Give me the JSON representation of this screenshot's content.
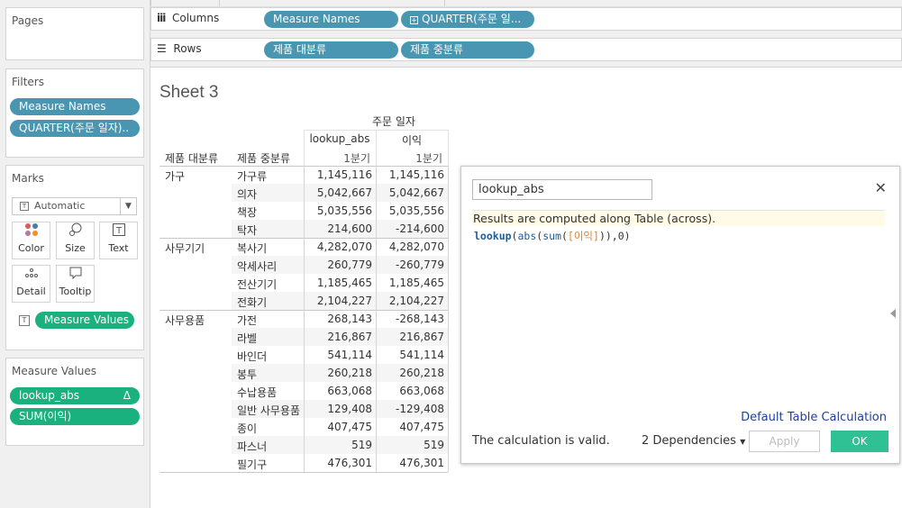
{
  "left": {
    "pages_title": "Pages",
    "filters_title": "Filters",
    "filters": [
      "Measure Names",
      "QUARTER(주문 일자).."
    ],
    "marks_title": "Marks",
    "marks_type": "Automatic",
    "marks_buttons": [
      "Color",
      "Size",
      "Text",
      "Detail",
      "Tooltip"
    ],
    "marks_pill": "Measure Values",
    "measure_values_title": "Measure Values",
    "measure_values": [
      "lookup_abs",
      "SUM(이익)"
    ],
    "delta_symbol": "Δ"
  },
  "shelves": {
    "columns_label": "Columns",
    "columns": [
      "Measure Names",
      "QUARTER(주문 일..."
    ],
    "rows_label": "Rows",
    "rows": [
      "제품 대분류",
      "제품 중분류"
    ]
  },
  "sheet": {
    "title": "Sheet 3",
    "col_group": "주문 일자",
    "measures": [
      "lookup_abs",
      "이익"
    ],
    "quarter": "1분기",
    "row_header_1": "제품 대분류",
    "row_header_2": "제품 중분류",
    "groups": [
      {
        "name": "가구",
        "rows": [
          [
            "가구류",
            "1,145,116",
            "1,145,116"
          ],
          [
            "의자",
            "5,042,667",
            "5,042,667"
          ],
          [
            "책장",
            "5,035,556",
            "5,035,556"
          ],
          [
            "탁자",
            "214,600",
            "-214,600"
          ]
        ]
      },
      {
        "name": "사무기기",
        "rows": [
          [
            "복사기",
            "4,282,070",
            "4,282,070"
          ],
          [
            "악세사리",
            "260,779",
            "-260,779"
          ],
          [
            "전산기기",
            "1,185,465",
            "1,185,465"
          ],
          [
            "전화기",
            "2,104,227",
            "2,104,227"
          ]
        ]
      },
      {
        "name": "사무용품",
        "rows": [
          [
            "가전",
            "268,143",
            "-268,143"
          ],
          [
            "라벨",
            "216,867",
            "216,867"
          ],
          [
            "바인더",
            "541,114",
            "541,114"
          ],
          [
            "봉투",
            "260,218",
            "260,218"
          ],
          [
            "수납용품",
            "663,068",
            "663,068"
          ],
          [
            "일반 사무용품",
            "129,408",
            "-129,408"
          ],
          [
            "종이",
            "407,475",
            "407,475"
          ],
          [
            "파스너",
            "519",
            "519"
          ],
          [
            "필기구",
            "476,301",
            "476,301"
          ]
        ]
      }
    ]
  },
  "dialog": {
    "name": "lookup_abs",
    "hint": "Results are computed along Table (across).",
    "formula_fn1": "lookup",
    "formula_p1": "(",
    "formula_fn2": "abs",
    "formula_p2": "(",
    "formula_fn3": "sum",
    "formula_p3": "(",
    "formula_field": "[이익]",
    "formula_end": ")),0)",
    "default_link": "Default Table Calculation",
    "status": "The calculation is valid.",
    "dependencies": "2 Dependencies",
    "apply": "Apply",
    "ok": "OK"
  }
}
